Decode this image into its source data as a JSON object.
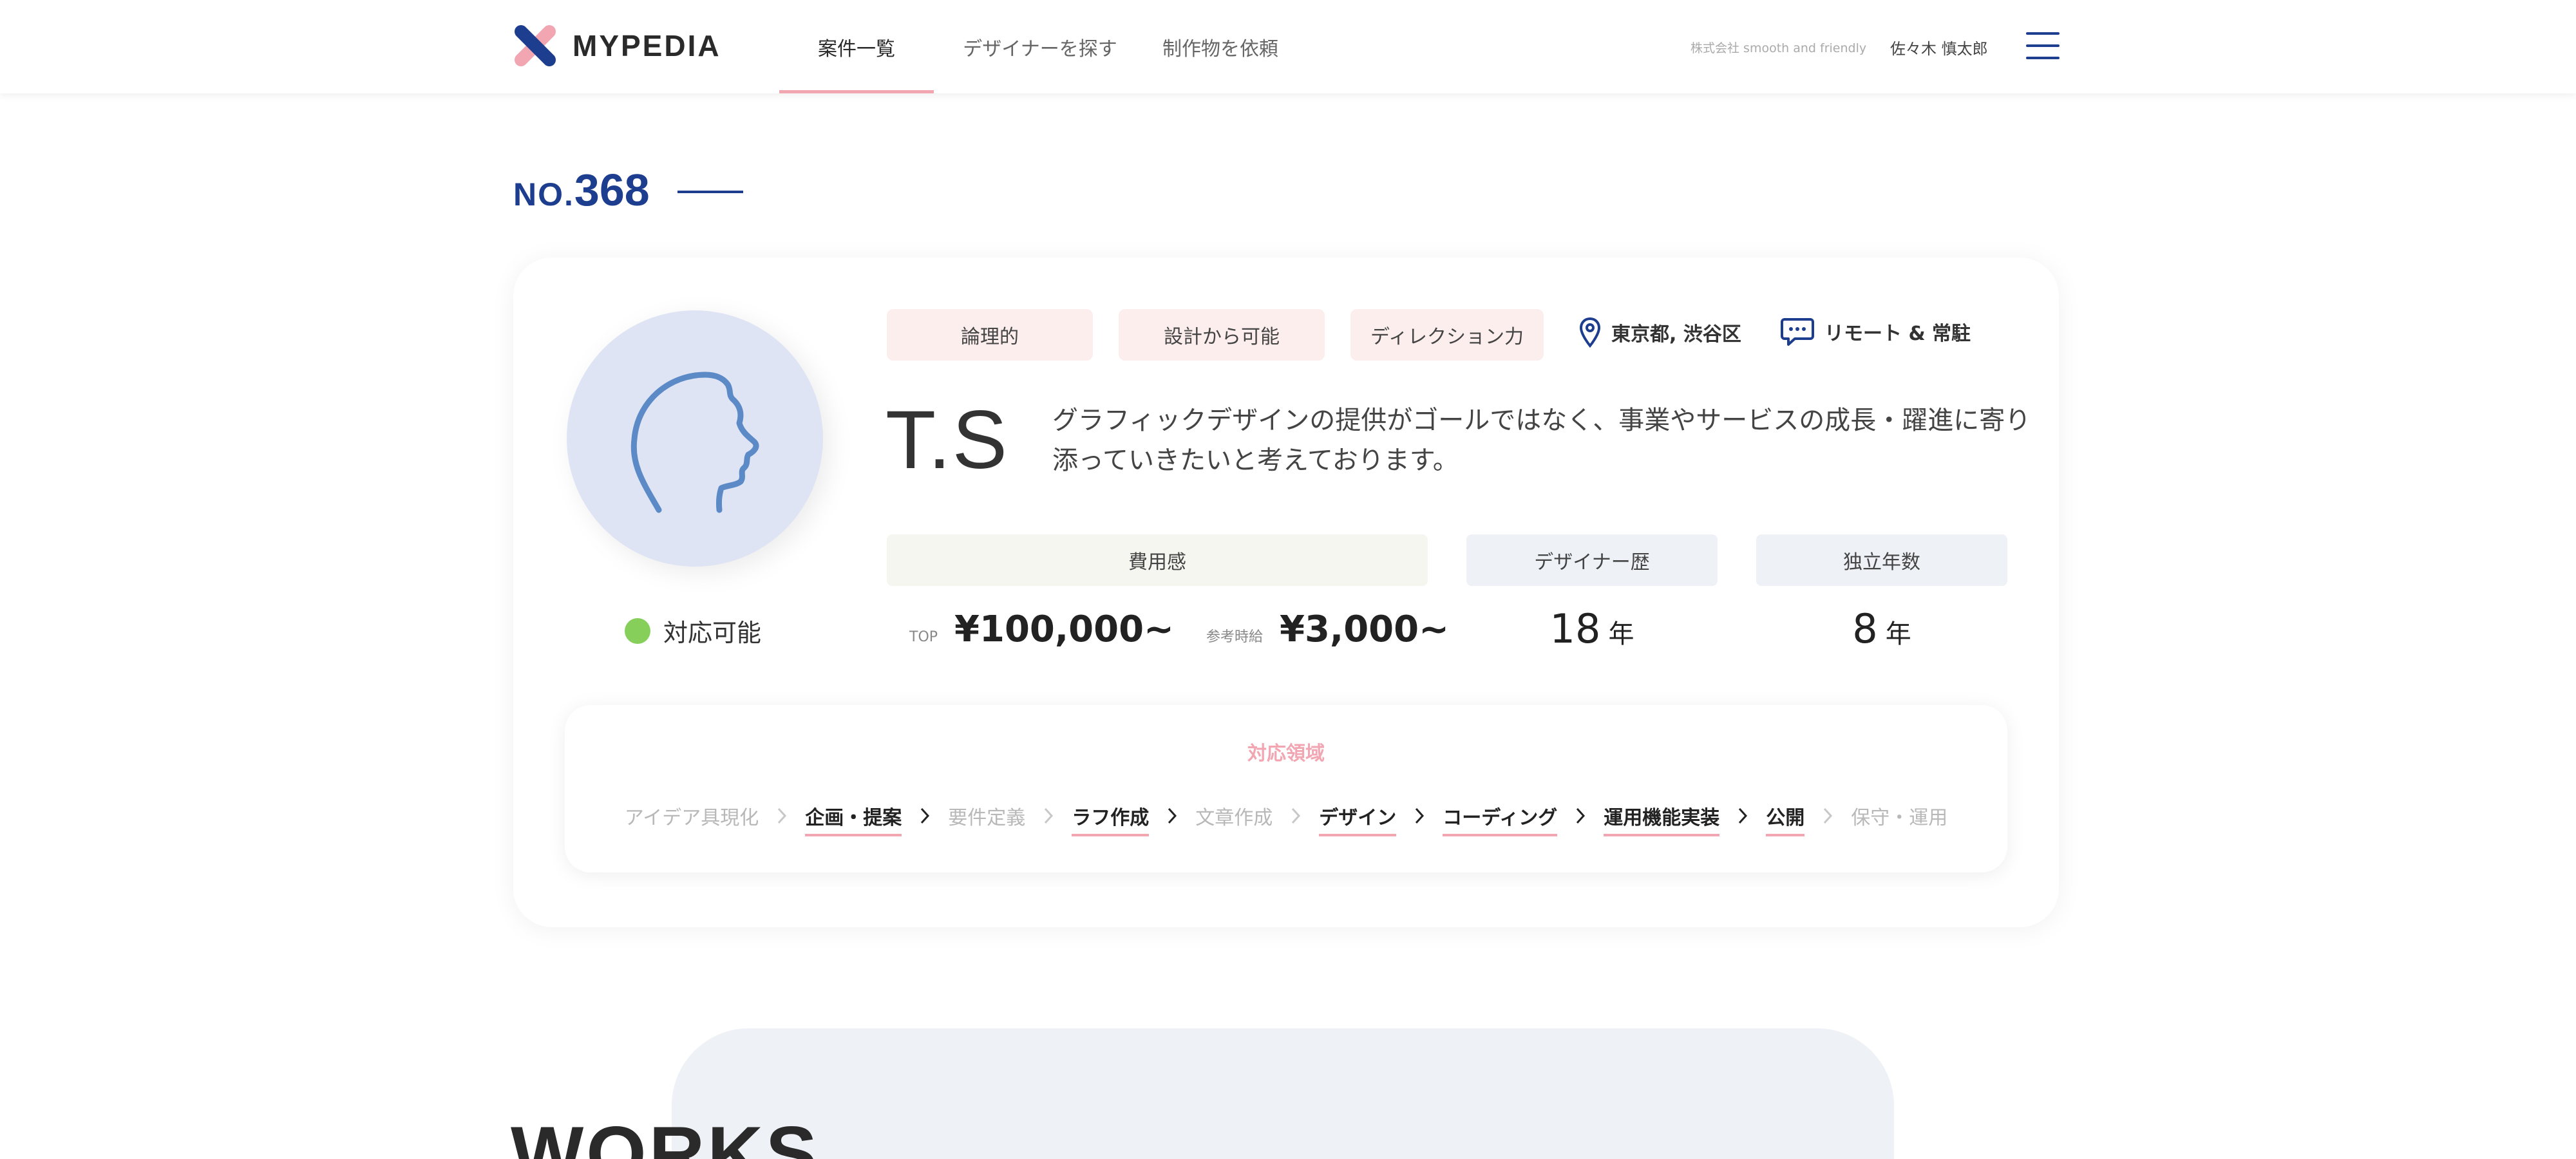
{
  "header": {
    "logo_text": "MYPEDIA",
    "nav": [
      {
        "label": "案件一覧",
        "active": true
      },
      {
        "label": "デザイナーを探す",
        "active": false
      },
      {
        "label": "制作物を依頼",
        "active": false
      }
    ],
    "company": "株式会社 smooth and friendly",
    "user_name": "佐々木 慎太郎"
  },
  "profile": {
    "number_prefix": "NO.",
    "number": "368",
    "status": "対応可能",
    "tags": [
      "論理的",
      "設計から可能",
      "ディレクション力"
    ],
    "location": "東京都, 渋谷区",
    "work_style": "リモート & 常駐",
    "initials": "T.S",
    "bio": "グラフィックデザインの提供がゴールではなく、事業やサービスの成長・躍進に寄り添っていきたいと考えております。",
    "cost": {
      "heading": "費用感",
      "top_label": "TOP",
      "top_value": "¥100,000~",
      "hourly_label": "参考時給",
      "hourly_value": "¥3,000~"
    },
    "career": {
      "heading": "デザイナー歴",
      "value": "18",
      "unit": "年"
    },
    "independent": {
      "heading": "独立年数",
      "value": "8",
      "unit": "年"
    }
  },
  "areas": {
    "title": "対応領域",
    "steps": [
      {
        "label": "アイデア具現化",
        "active": false
      },
      {
        "label": "企画・提案",
        "active": true
      },
      {
        "label": "要件定義",
        "active": false
      },
      {
        "label": "ラフ作成",
        "active": true
      },
      {
        "label": "文章作成",
        "active": false
      },
      {
        "label": "デザイン",
        "active": true
      },
      {
        "label": "コーディング",
        "active": true
      },
      {
        "label": "運用機能実装",
        "active": true
      },
      {
        "label": "公開",
        "active": true
      },
      {
        "label": "保守・運用",
        "active": false
      }
    ]
  },
  "works": {
    "title": "WORKS"
  },
  "colors": {
    "brand_blue": "#1d3e8e",
    "accent_pink": "#f1a6b2",
    "status_green": "#86cf5a",
    "tag_bg": "#fdeeee",
    "avatar_bg": "#dfe4f4"
  }
}
